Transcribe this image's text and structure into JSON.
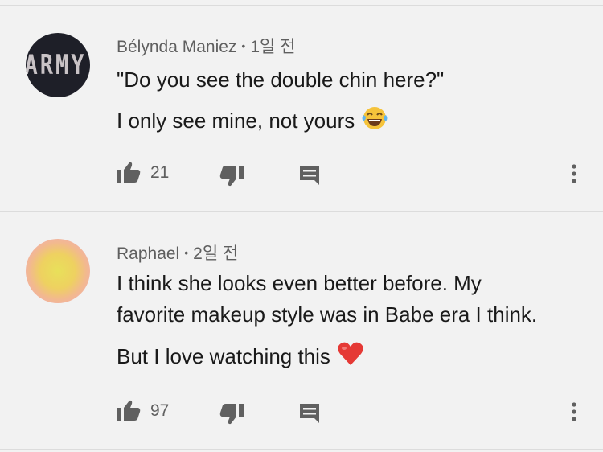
{
  "comments": [
    {
      "author": "Bélynda Maniez",
      "time": "1일 전",
      "avatar_text": "ARMY",
      "lines": [
        "\"Do you see the double chin here?\"",
        "I only see mine, not yours"
      ],
      "emoji": "laughing-tears-emoji",
      "likes": "21"
    },
    {
      "author": "Raphael",
      "time": "2일 전",
      "lines": [
        "I think she looks even better before. My",
        "favorite makeup style was in Babe era I think.",
        "But I love watching this"
      ],
      "emoji": "red-heart-emoji",
      "likes": "97"
    }
  ],
  "icons": {
    "like": "thumbs-up-icon",
    "dislike": "thumbs-down-icon",
    "reply": "reply-comment-icon",
    "menu": "more-vertical-icon"
  },
  "colors": {
    "background": "#f2f2f2",
    "icon": "#606060",
    "divider": "#dcdcdc"
  }
}
